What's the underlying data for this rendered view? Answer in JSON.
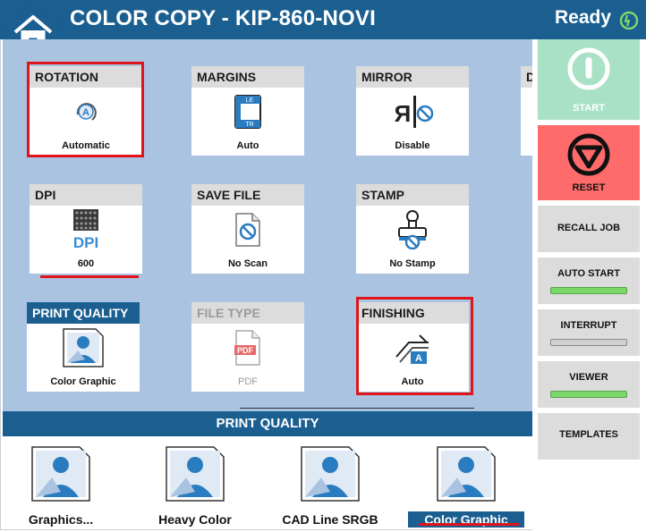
{
  "header": {
    "title": "COLOR COPY - KIP-860-NOVI",
    "status": "Ready"
  },
  "settings": [
    {
      "key": "rotation",
      "label": "ROTATION",
      "value": "Automatic"
    },
    {
      "key": "margins",
      "label": "MARGINS",
      "value": "Auto"
    },
    {
      "key": "mirror",
      "label": "MIRROR",
      "value": "Disable"
    },
    {
      "key": "partial",
      "label": "D",
      "value": ""
    },
    {
      "key": "dpi",
      "label": "DPI",
      "value": "600"
    },
    {
      "key": "save_file",
      "label": "SAVE FILE",
      "value": "No Scan"
    },
    {
      "key": "stamp",
      "label": "STAMP",
      "value": "No Stamp"
    },
    {
      "key": "print_quality",
      "label": "PRINT QUALITY",
      "value": "Color Graphic"
    },
    {
      "key": "file_type",
      "label": "FILE TYPE",
      "value": "PDF"
    },
    {
      "key": "finishing",
      "label": "FINISHING",
      "value": "Auto"
    }
  ],
  "icon_text": {
    "margins_top": "LE",
    "margins_bottom": "TR",
    "dpi": "DPI",
    "pdf": "PDF",
    "finishing": "A",
    "rotation": "A"
  },
  "print_quality_bar": {
    "title": "PRINT QUALITY",
    "options": [
      "Graphics...",
      "Heavy Color",
      "CAD Line SRGB",
      "Color Graphic"
    ],
    "selected": "Color Graphic"
  },
  "side_panel": {
    "start": "START",
    "reset": "RESET",
    "recall_job": "RECALL JOB",
    "auto_start": "AUTO START",
    "interrupt": "INTERRUPT",
    "viewer": "VIEWER",
    "templates": "TEMPLATES",
    "auto_start_on": true,
    "interrupt_on": false,
    "viewer_on": true
  },
  "colors": {
    "brand_blue": "#1b5f91",
    "panel_bg": "#a9c3e1",
    "start_green": "#a9e1c6",
    "reset_red": "#ff6b6b",
    "highlight_red": "#e0151b",
    "indicator_on": "#7bd86b"
  },
  "icons": [
    "home-icon",
    "ready-icon",
    "rotation-icon",
    "margins-icon",
    "mirror-icon",
    "dpi-icon",
    "save-file-icon",
    "stamp-icon",
    "print-quality-icon",
    "pdf-icon",
    "finishing-icon",
    "start-icon",
    "reset-icon"
  ]
}
